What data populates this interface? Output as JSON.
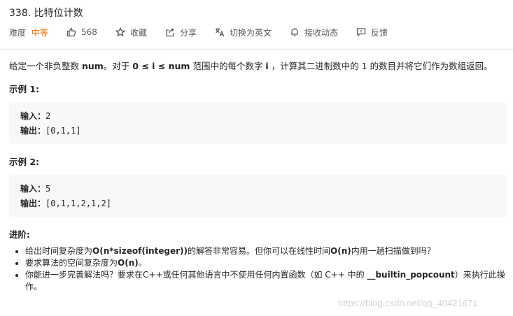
{
  "problem": {
    "title": "338. 比特位计数"
  },
  "meta": {
    "difficulty_label": "难度",
    "difficulty_value": "中等",
    "difficulty_color": "#ef6c00",
    "likes": "568",
    "favorite": "收藏",
    "share": "分享",
    "translate": "切换为英文",
    "notify": "接收动态",
    "feedback": "反馈"
  },
  "description": {
    "p1": "给定一个非负整数 ",
    "num1": "num",
    "p2": "。对于 ",
    "range": "0 ≤ i ≤ num",
    "p3": " 范围中的每个数字 ",
    "var_i": "i",
    "p4": " ，计算其二进制数中的 1 的数目并将它们作为数组返回。"
  },
  "examples": [
    {
      "heading": "示例 1:",
      "input_label": "输入：",
      "input_value": "2",
      "output_label": "输出：",
      "output_value": "[0,1,1]"
    },
    {
      "heading": "示例 2:",
      "input_label": "输入：",
      "input_value": "5",
      "output_label": "输出：",
      "output_value": "[0,1,1,2,1,2]"
    }
  ],
  "advanced": {
    "heading": "进阶:",
    "item1_a": "给出时间复杂度为",
    "item1_b": "O(n*sizeof(integer))",
    "item1_c": "的解答非常容易。但你可以在线性时间",
    "item1_d": "O(n)",
    "item1_e": "内用一趟扫描做到吗？",
    "item2_a": "要求算法的空间复杂度为",
    "item2_b": "O(n)",
    "item2_c": "。",
    "item3_a": "你能进一步完善解法吗？要求在C++或任何其他语言中不使用任何内置函数（如 C++ 中的 ",
    "item3_b": "__builtin_popcount",
    "item3_c": "）来执行此操作。"
  },
  "watermark": "https://blog.csdn.net/qq_40421671"
}
